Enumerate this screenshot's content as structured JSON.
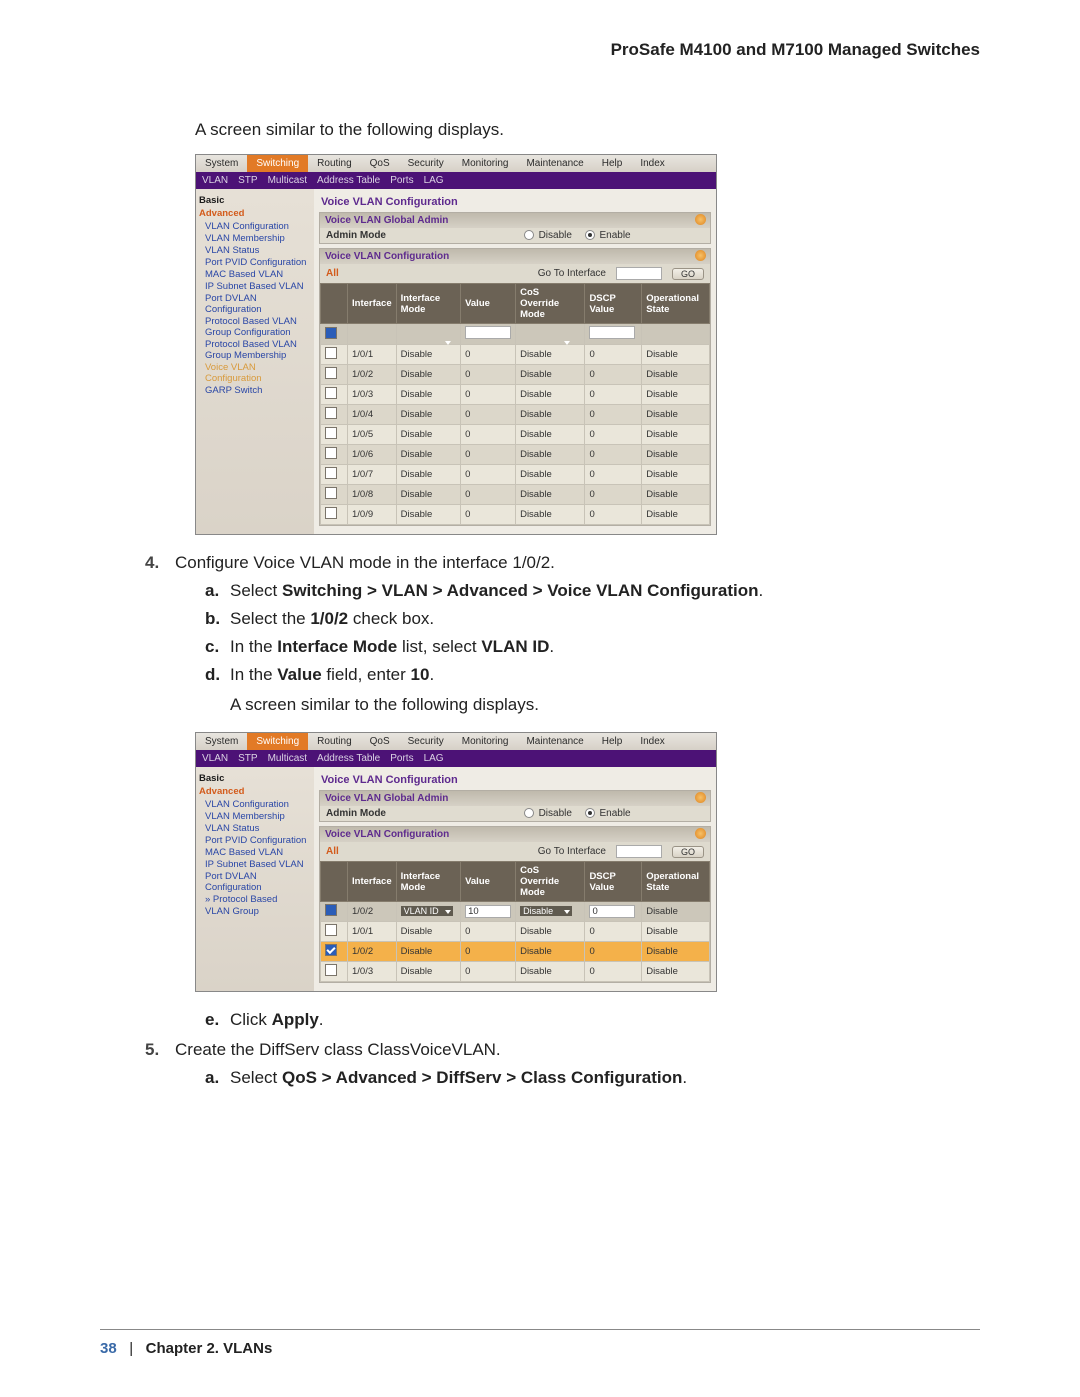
{
  "header": {
    "title": "ProSafe M4100 and M7100 Managed Switches"
  },
  "intro1": "A screen similar to the following displays.",
  "intro2": "A screen similar to the following displays.",
  "steps": {
    "s4": {
      "num": "4.",
      "text": "Configure Voice VLAN mode in the interface 1/0/2.",
      "a": {
        "let": "a.",
        "pre": "Select ",
        "bold": "Switching > VLAN > Advanced > Voice VLAN Configuration",
        "post": "."
      },
      "b": {
        "let": "b.",
        "pre": "Select the ",
        "bold": "1/0/2",
        "post": " check box."
      },
      "c": {
        "let": "c.",
        "pre": "In the ",
        "bold1": "Interface Mode",
        "mid": " list, select ",
        "bold2": "VLAN ID",
        "post": "."
      },
      "d": {
        "let": "d.",
        "pre": "In the ",
        "bold1": "Value",
        "mid": " field, enter ",
        "bold2": "10",
        "post": "."
      },
      "e": {
        "let": "e.",
        "pre": "Click ",
        "bold": "Apply",
        "post": "."
      }
    },
    "s5": {
      "num": "5.",
      "text": "Create the DiffServ class ClassVoiceVLAN.",
      "a": {
        "let": "a.",
        "pre": "Select ",
        "bold": "QoS > Advanced > DiffServ > Class Configuration",
        "post": "."
      }
    }
  },
  "screenshot_common": {
    "top_tabs": [
      "System",
      "Switching",
      "Routing",
      "QoS",
      "Security",
      "Monitoring",
      "Maintenance",
      "Help",
      "Index"
    ],
    "active_top": "Switching",
    "sub_tabs": [
      "VLAN",
      "STP",
      "Multicast",
      "Address Table",
      "Ports",
      "LAG"
    ],
    "title": "Voice VLAN Configuration",
    "panel_global": {
      "hdr": "Voice VLAN Global Admin",
      "admin_label": "Admin Mode",
      "opt_disable": "Disable",
      "opt_enable": "Enable"
    },
    "panel_conf": {
      "hdr": "Voice VLAN Configuration",
      "all": "All",
      "goto": "Go To Interface",
      "go": "GO",
      "cols": [
        "",
        "Interface",
        "Interface Mode",
        "Value",
        "CoS Override Mode",
        "DSCP Value",
        "Operational State"
      ]
    }
  },
  "sidebar": {
    "basic": "Basic",
    "advanced": "Advanced",
    "items": [
      "VLAN Configuration",
      "VLAN Membership",
      "VLAN Status",
      "Port PVID Configuration",
      "MAC Based VLAN",
      "IP Subnet Based VLAN",
      "Port DVLAN Configuration",
      "Protocol Based VLAN Group Configuration",
      "Protocol Based VLAN Group Membership",
      "Voice VLAN Configuration",
      "GARP Switch"
    ]
  },
  "sidebar2_extra": "VLAN Group",
  "shot1_rows": [
    {
      "if": "1/0/1",
      "mode": "Disable",
      "val": "0",
      "cos": "Disable",
      "dscp": "0",
      "op": "Disable"
    },
    {
      "if": "1/0/2",
      "mode": "Disable",
      "val": "0",
      "cos": "Disable",
      "dscp": "0",
      "op": "Disable"
    },
    {
      "if": "1/0/3",
      "mode": "Disable",
      "val": "0",
      "cos": "Disable",
      "dscp": "0",
      "op": "Disable"
    },
    {
      "if": "1/0/4",
      "mode": "Disable",
      "val": "0",
      "cos": "Disable",
      "dscp": "0",
      "op": "Disable"
    },
    {
      "if": "1/0/5",
      "mode": "Disable",
      "val": "0",
      "cos": "Disable",
      "dscp": "0",
      "op": "Disable"
    },
    {
      "if": "1/0/6",
      "mode": "Disable",
      "val": "0",
      "cos": "Disable",
      "dscp": "0",
      "op": "Disable"
    },
    {
      "if": "1/0/7",
      "mode": "Disable",
      "val": "0",
      "cos": "Disable",
      "dscp": "0",
      "op": "Disable"
    },
    {
      "if": "1/0/8",
      "mode": "Disable",
      "val": "0",
      "cos": "Disable",
      "dscp": "0",
      "op": "Disable"
    },
    {
      "if": "1/0/9",
      "mode": "Disable",
      "val": "0",
      "cos": "Disable",
      "dscp": "0",
      "op": "Disable"
    }
  ],
  "shot2_edit": {
    "if": "1/0/2",
    "mode": "VLAN ID",
    "val": "10",
    "cos": "Disable",
    "dscp": "0",
    "op": "Disable"
  },
  "shot2_rows": [
    {
      "if": "1/0/1",
      "mode": "Disable",
      "val": "0",
      "cos": "Disable",
      "dscp": "0",
      "op": "Disable"
    },
    {
      "if": "1/0/2",
      "mode": "Disable",
      "val": "0",
      "cos": "Disable",
      "dscp": "0",
      "op": "Disable",
      "sel": true
    },
    {
      "if": "1/0/3",
      "mode": "Disable",
      "val": "0",
      "cos": "Disable",
      "dscp": "0",
      "op": "Disable"
    }
  ],
  "footer": {
    "page": "38",
    "sep": "|",
    "chapter": "Chapter 2.  VLANs"
  }
}
